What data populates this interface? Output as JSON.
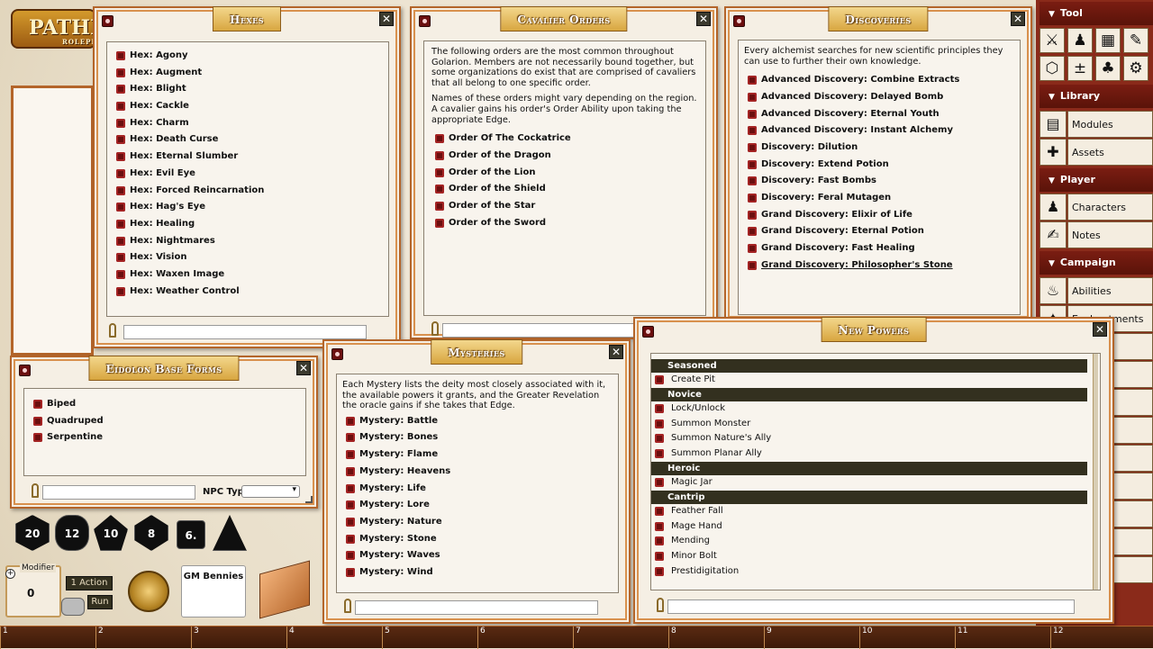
{
  "app": {
    "logo_text": "PATHF",
    "logo_sub": "ROLEPLA"
  },
  "hexes": {
    "title": "Hexes",
    "items": [
      "Hex: Agony",
      "Hex: Augment",
      "Hex: Blight",
      "Hex: Cackle",
      "Hex: Charm",
      "Hex: Death Curse",
      "Hex: Eternal Slumber",
      "Hex: Evil Eye",
      "Hex: Forced Reincarnation",
      "Hex: Hag's Eye",
      "Hex: Healing",
      "Hex: Nightmares",
      "Hex: Vision",
      "Hex: Waxen Image",
      "Hex: Weather Control"
    ]
  },
  "cavalier": {
    "title": "Cavalier Orders",
    "desc1": "The following orders are the most common throughout Golarion. Members are not necessarily bound together, but some organizations do exist that are comprised of cavaliers that all belong to one specific order.",
    "desc2": "Names of these orders might vary depending on the region. A cavalier gains his order's Order Ability upon taking the appropriate Edge.",
    "items": [
      "Order Of The Cockatrice",
      "Order of the Dragon",
      "Order of the Lion",
      "Order of the Shield",
      "Order of the Star",
      "Order of the Sword"
    ]
  },
  "discoveries": {
    "title": "Discoveries",
    "desc": "Every alchemist searches for new scientific principles they can use to further their own knowledge.",
    "items": [
      "Advanced Discovery: Combine Extracts",
      "Advanced Discovery: Delayed Bomb",
      "Advanced Discovery: Eternal Youth",
      "Advanced Discovery: Instant Alchemy",
      "Discovery: Dilution",
      "Discovery: Extend Potion",
      "Discovery: Fast Bombs",
      "Discovery: Feral Mutagen",
      "Grand Discovery: Elixir of Life",
      "Grand Discovery: Eternal Potion",
      "Grand Discovery: Fast Healing",
      "Grand Discovery: Philosopher's Stone"
    ]
  },
  "eidolon": {
    "title": "Eidolon Base Forms",
    "items": [
      "Biped",
      "Quadruped",
      "Serpentine"
    ],
    "npc_type_label": "NPC Type"
  },
  "mysteries": {
    "title": "Mysteries",
    "desc": "Each Mystery lists the deity most closely associated with it, the available powers it grants, and the Greater Revelation the oracle gains if she takes that Edge.",
    "items": [
      "Mystery: Battle",
      "Mystery: Bones",
      "Mystery: Flame",
      "Mystery: Heavens",
      "Mystery: Life",
      "Mystery: Lore",
      "Mystery: Nature",
      "Mystery: Stone",
      "Mystery: Waves",
      "Mystery: Wind"
    ]
  },
  "powers": {
    "title": "New Powers",
    "groups": [
      {
        "name": "Seasoned",
        "items": [
          "Create Pit"
        ]
      },
      {
        "name": "Novice",
        "items": [
          "Lock/Unlock",
          "Summon Monster",
          "Summon Nature's Ally",
          "Summon Planar Ally"
        ]
      },
      {
        "name": "Heroic",
        "items": [
          "Magic Jar"
        ]
      },
      {
        "name": "Cantrip",
        "items": [
          "Feather Fall",
          "Mage Hand",
          "Mending",
          "Minor Bolt",
          "Prestidigitation"
        ]
      }
    ]
  },
  "sidebar": {
    "tool_header": "Tool",
    "library_header": "Library",
    "player_header": "Player",
    "campaign_header": "Campaign",
    "modules": "Modules",
    "assets": "Assets",
    "characters": "Characters",
    "notes": "Notes",
    "abilities": "Abilities",
    "enchantments": "Enchantments"
  },
  "dice": [
    "20",
    "12",
    "10",
    "8",
    "6.",
    ""
  ],
  "controls": {
    "modifier_label": "Modifier",
    "modifier_value": "0",
    "action_label": "1 Action",
    "run_label": "Run",
    "bennies_label": "GM Bennies"
  },
  "hotbar": [
    "1",
    "2",
    "3",
    "4",
    "5",
    "6",
    "7",
    "8",
    "9",
    "10",
    "11",
    "12"
  ]
}
